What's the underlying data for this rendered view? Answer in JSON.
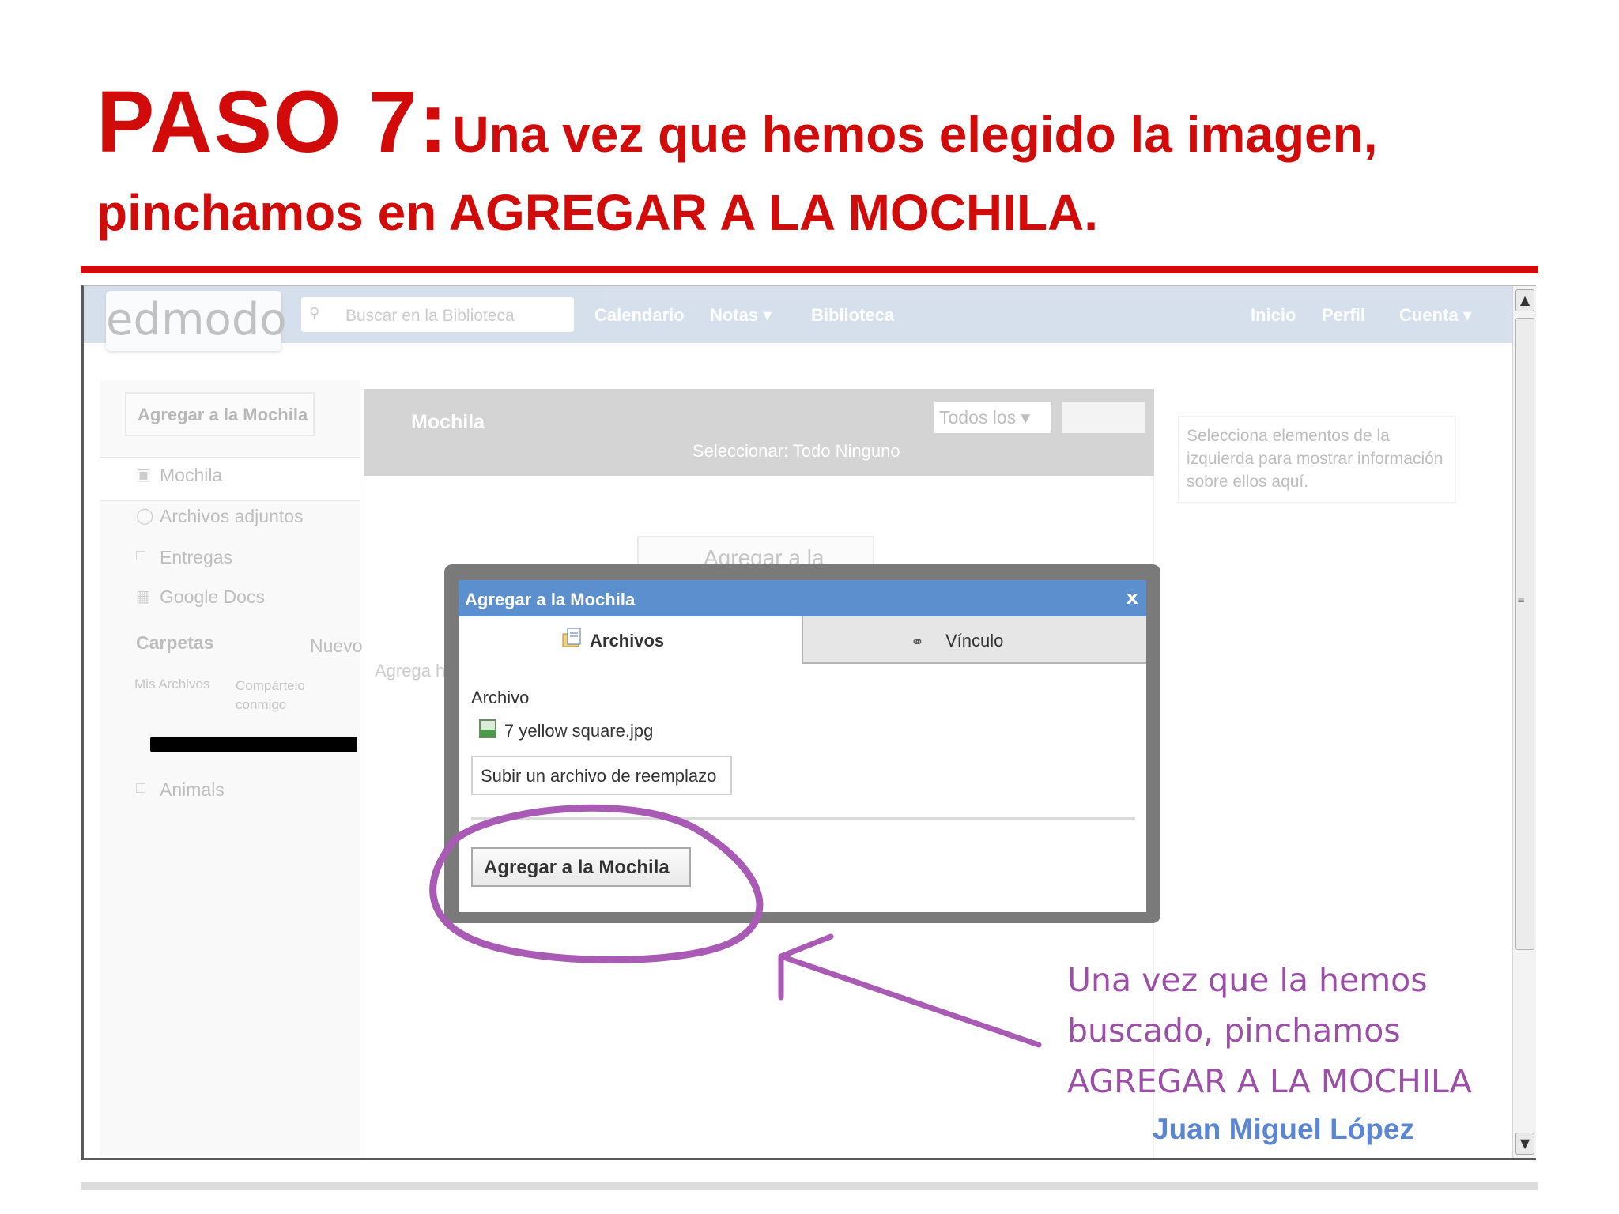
{
  "slide": {
    "step": "PASO 7:",
    "title_line1": "Una vez que hemos elegido la imagen,",
    "title_line2": "pinchamos en AGREGAR A LA MOCHILA."
  },
  "colors": {
    "title_red": "#d10a0a",
    "annotation_purple": "#9c4fa7",
    "author_blue": "#5b86d4",
    "dialog_header": "#5b8fcd"
  },
  "app": {
    "logo": "edmodo",
    "search": {
      "placeholder": "Buscar en la Biblioteca",
      "icon": "search-icon"
    },
    "nav_left": [
      "Calendario",
      "Notas",
      "Biblioteca"
    ],
    "nav_right": [
      "Inicio",
      "Perfil",
      "Cuenta"
    ],
    "sidebar": {
      "add_button": "Agregar a la Mochila",
      "items": [
        "Mochila",
        "Archivos adjuntos",
        "Entregas",
        "Google Docs"
      ],
      "folders_label": "Carpetas",
      "new_label": "Nuevo",
      "my_files": "Mis Archivos",
      "shared": "Compártelo conmigo",
      "folder_item": "Animals"
    },
    "center": {
      "title": "Mochila",
      "select_text": "Seleccionar: Todo Ninguno",
      "filter": "Todos los",
      "ghost_button": "Agregar a la",
      "agrega_text": "Agrega h"
    },
    "info_text": "Selecciona elementos de la izquierda para mostrar información sobre ellos aquí."
  },
  "dialog": {
    "title": "Agregar a la Mochila",
    "close": "x",
    "tab_files": "Archivos",
    "tab_link": "Vínculo",
    "file_label": "Archivo",
    "file_name": "7 yellow square.jpg",
    "replace_button": "Subir un archivo de reemplazo",
    "submit_button": "Agregar a la Mochila"
  },
  "annotation": {
    "line1": "Una vez que la hemos",
    "line2": "buscado, pinchamos",
    "line3": "AGREGAR A LA MOCHILA",
    "author": "Juan Miguel López"
  }
}
